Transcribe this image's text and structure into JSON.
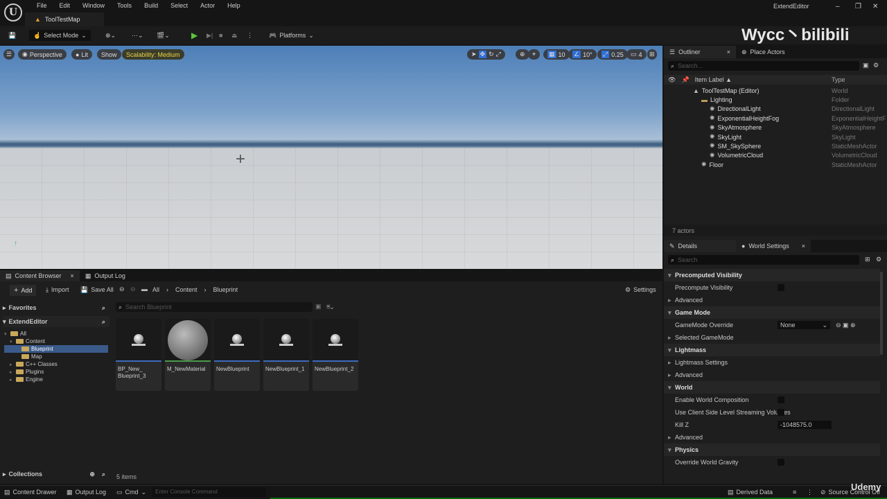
{
  "menubar": {
    "items": [
      "File",
      "Edit",
      "Window",
      "Tools",
      "Build",
      "Select",
      "Actor",
      "Help"
    ],
    "map_tab": "ToolTestMap",
    "app_title": "ExtendEditor"
  },
  "toolbar": {
    "select_mode": "Select Mode",
    "platforms": "Platforms"
  },
  "viewport": {
    "perspective": "Perspective",
    "lit": "Lit",
    "show": "Show",
    "scalability": "Scalability: Medium",
    "grid_snap": "10",
    "rot_snap": "10°",
    "scale_snap": "0.25",
    "cam_speed": "4"
  },
  "watermark": {
    "text": "Wycc丶bilibili"
  },
  "outliner": {
    "tab": "Outliner",
    "place_actors": "Place Actors",
    "search_placeholder": "Search...",
    "col_label": "Item Label ▲",
    "col_type": "Type",
    "rows": [
      {
        "label": "ToolTestMap (Editor)",
        "type": "World",
        "depth": 1
      },
      {
        "label": "Lighting",
        "type": "Folder",
        "depth": 2
      },
      {
        "label": "DirectionalLight",
        "type": "DirectionalLight",
        "depth": 3
      },
      {
        "label": "ExponentialHeightFog",
        "type": "ExponentialHeightFog",
        "depth": 3
      },
      {
        "label": "SkyAtmosphere",
        "type": "SkyAtmosphere",
        "depth": 3
      },
      {
        "label": "SkyLight",
        "type": "SkyLight",
        "depth": 3
      },
      {
        "label": "SM_SkySphere",
        "type": "StaticMeshActor",
        "depth": 3
      },
      {
        "label": "VolumetricCloud",
        "type": "VolumetricCloud",
        "depth": 3
      },
      {
        "label": "Floor",
        "type": "StaticMeshActor",
        "depth": 2
      }
    ],
    "footer": "7 actors"
  },
  "details": {
    "tab": "Details",
    "world_settings": "World Settings",
    "search_placeholder": "Search",
    "rows": [
      {
        "label": "Precomputed Visibility",
        "kind": "cat"
      },
      {
        "label": "Precompute Visibility",
        "kind": "check"
      },
      {
        "label": "Advanced",
        "kind": "sub"
      },
      {
        "label": "Game Mode",
        "kind": "cat"
      },
      {
        "label": "GameMode Override",
        "kind": "select",
        "value": "None"
      },
      {
        "label": "Selected GameMode",
        "kind": "sub"
      },
      {
        "label": "Lightmass",
        "kind": "cat"
      },
      {
        "label": "Lightmass Settings",
        "kind": "sub"
      },
      {
        "label": "Advanced",
        "kind": "sub"
      },
      {
        "label": "World",
        "kind": "cat"
      },
      {
        "label": "Enable World Composition",
        "kind": "check"
      },
      {
        "label": "Use Client Side Level Streaming Volumes",
        "kind": "check"
      },
      {
        "label": "Kill Z",
        "kind": "number",
        "value": "-1048575.0"
      },
      {
        "label": "Advanced",
        "kind": "sub"
      },
      {
        "label": "Physics",
        "kind": "cat"
      },
      {
        "label": "Override World Gravity",
        "kind": "check"
      }
    ]
  },
  "content_browser": {
    "tab": "Content Browser",
    "output_log_tab": "Output Log",
    "add": "Add",
    "import": "Import",
    "save_all": "Save All",
    "breadcrumb": [
      "All",
      "Content",
      "Blueprint"
    ],
    "settings": "Settings",
    "favorites": "Favorites",
    "project": "ExtendEditor",
    "tree": [
      {
        "label": "All",
        "depth": 0
      },
      {
        "label": "Content",
        "depth": 1
      },
      {
        "label": "Blueprint",
        "depth": 2,
        "selected": true
      },
      {
        "label": "Map",
        "depth": 2
      },
      {
        "label": "C++ Classes",
        "depth": 1
      },
      {
        "label": "Plugins",
        "depth": 1
      },
      {
        "label": "Engine",
        "depth": 1
      }
    ],
    "search_placeholder": "Search Blueprint",
    "assets": [
      {
        "name": "BP_New_ Blueprint_3",
        "kind": "blueprint"
      },
      {
        "name": "M_NewMaterial",
        "kind": "material"
      },
      {
        "name": "NewBlueprint",
        "kind": "blueprint"
      },
      {
        "name": "NewBlueprint_1",
        "kind": "blueprint"
      },
      {
        "name": "NewBlueprint_2",
        "kind": "blueprint"
      }
    ],
    "collections": "Collections",
    "item_count": "5 items"
  },
  "statusbar": {
    "content_drawer": "Content Drawer",
    "output_log": "Output Log",
    "cmd": "Cmd",
    "console_placeholder": "Enter Console Command",
    "derived_data": "Derived Data",
    "source_control": "Source Control Off",
    "udemy": "Udemy"
  }
}
